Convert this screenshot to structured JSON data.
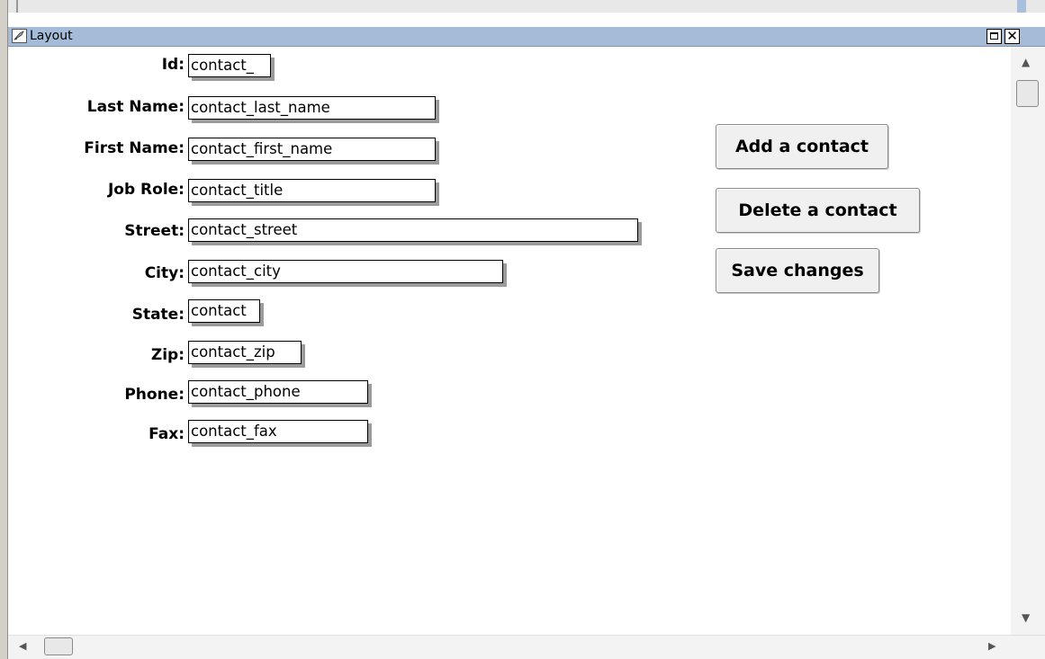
{
  "window": {
    "title": "Layout"
  },
  "form": {
    "fields": [
      {
        "label": "Id:",
        "value": "contact_"
      },
      {
        "label": "Last Name:",
        "value": "contact_last_name"
      },
      {
        "label": "First Name:",
        "value": "contact_first_name"
      },
      {
        "label": "Job Role:",
        "value": "contact_title"
      },
      {
        "label": "Street:",
        "value": "contact_street"
      },
      {
        "label": "City:",
        "value": "contact_city"
      },
      {
        "label": "State:",
        "value": "contact"
      },
      {
        "label": "Zip:",
        "value": "contact_zip"
      },
      {
        "label": "Phone:",
        "value": "contact_phone"
      },
      {
        "label": "Fax:",
        "value": "contact_fax"
      }
    ]
  },
  "buttons": {
    "add": "Add a contact",
    "delete": "Delete a contact",
    "save": "Save changes"
  },
  "icons": {
    "window": "layout-icon",
    "maximize": "maximize-icon",
    "close": "close-icon"
  },
  "colors": {
    "titlebar": "#a4bcd8"
  }
}
